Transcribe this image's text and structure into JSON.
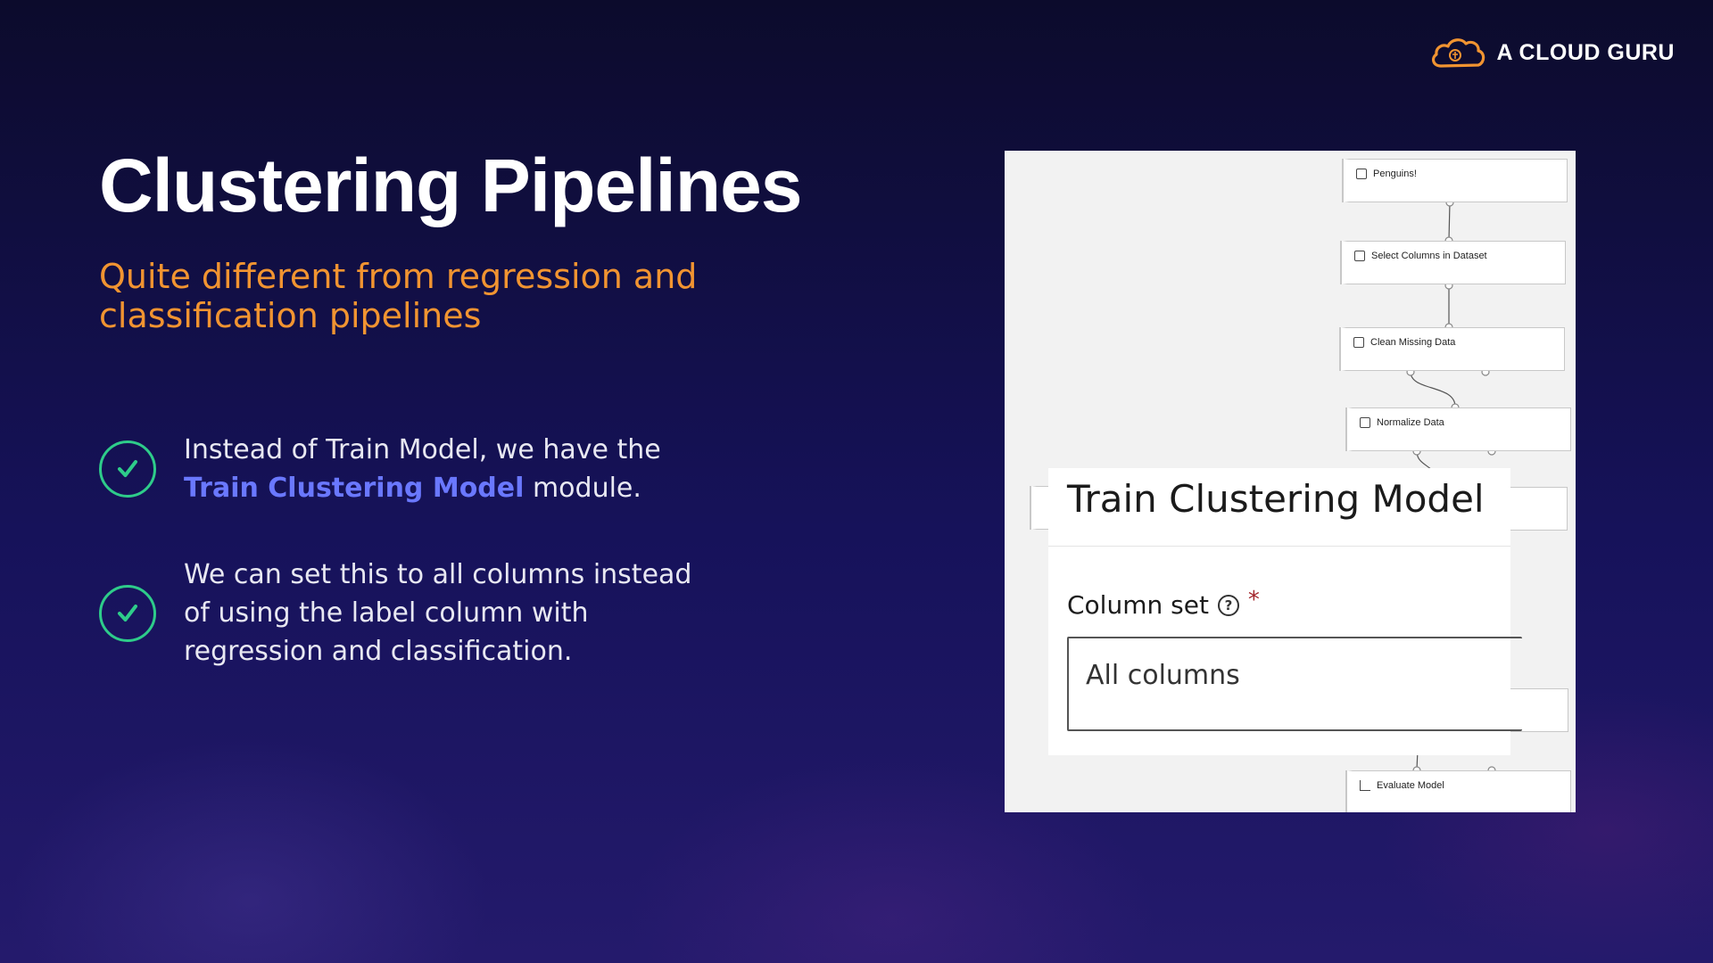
{
  "brand": {
    "name": "A CLOUD GURU",
    "colors": {
      "accent": "#f19431"
    }
  },
  "slide": {
    "title": "Clustering Pipelines",
    "subtitle": "Quite different from regression and classification pipelines",
    "bullets": [
      {
        "icon": "check-circle-icon",
        "text_before": "Instead of Train Model, we have the ",
        "highlight": "Train Clustering Model",
        "text_after": " module."
      },
      {
        "icon": "check-circle-icon",
        "text": "We can set this to all columns instead of using the label column with regression and classification."
      }
    ],
    "colors": {
      "subtitle": "#f19431",
      "highlight": "#6a78ff",
      "check": "#2ecc8a"
    }
  },
  "pipeline": {
    "nodes": [
      {
        "label": "Penguins!",
        "icon": "dataset-icon"
      },
      {
        "label": "Select Columns in Dataset",
        "icon": "module-icon"
      },
      {
        "label": "Clean Missing Data",
        "icon": "module-icon"
      },
      {
        "label": "Normalize Data",
        "icon": "module-icon"
      },
      {
        "label": "Evaluate Model",
        "icon": "chart-icon"
      }
    ],
    "panel": {
      "title": "Train Clustering Model",
      "field_label": "Column set",
      "required_mark": "*",
      "help_icon": "help-circle-icon",
      "selected_value": "All columns"
    }
  }
}
